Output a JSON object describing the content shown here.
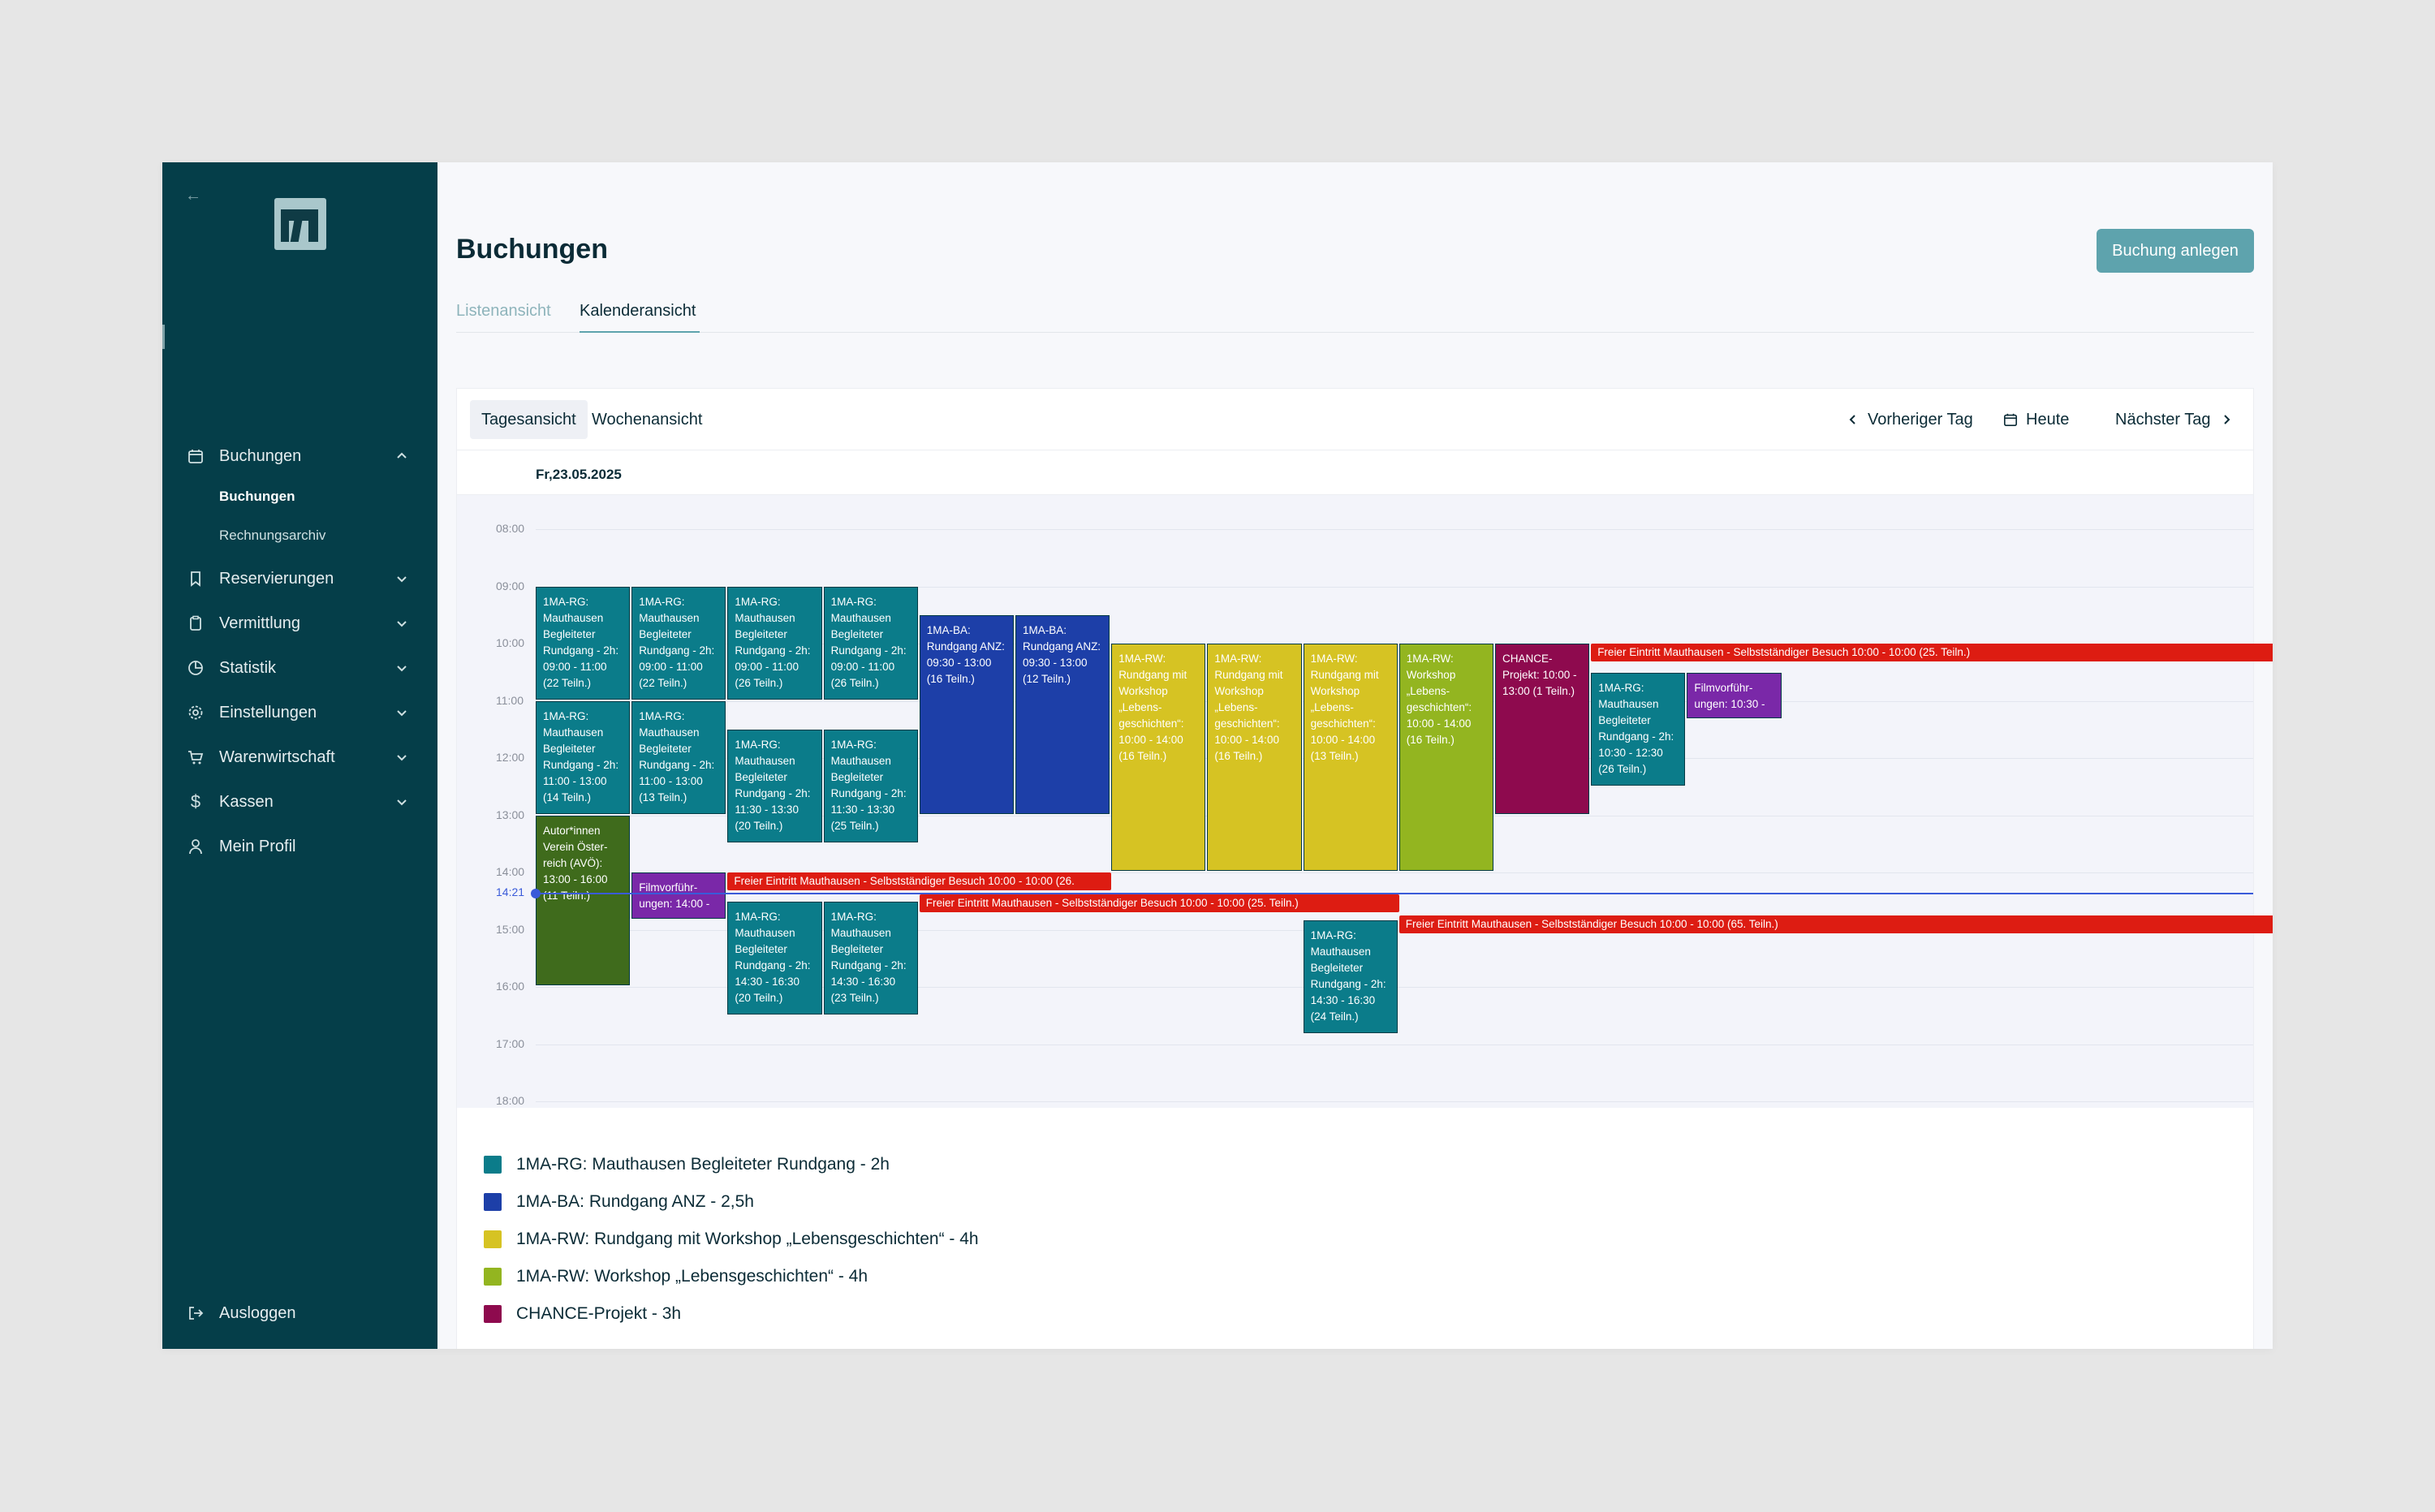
{
  "sidebar": {
    "groups": [
      {
        "label": "Buchungen",
        "icon": "calendar-icon",
        "expanded": true
      },
      {
        "label": "Reservierungen",
        "icon": "bookmark-icon"
      },
      {
        "label": "Vermittlung",
        "icon": "clipboard-icon"
      },
      {
        "label": "Statistik",
        "icon": "pie-chart-icon"
      },
      {
        "label": "Einstellungen",
        "icon": "gear-icon"
      },
      {
        "label": "Warenwirtschaft",
        "icon": "cart-icon"
      },
      {
        "label": "Kassen",
        "icon": "dollar-icon"
      },
      {
        "label": "Mein Profil",
        "icon": "user-icon"
      }
    ],
    "sub_items": [
      "Buchungen",
      "Rechnungsarchiv"
    ],
    "logout": "Ausloggen"
  },
  "header": {
    "title": "Buchungen",
    "create_button": "Buchung anlegen",
    "tabs": [
      "Listenansicht",
      "Kalenderansicht"
    ]
  },
  "calendar": {
    "views": [
      "Tagesansicht",
      "Wochenansicht"
    ],
    "prev": "Vorheriger Tag",
    "today": "Heute",
    "next": "Nächster Tag",
    "date": "Fr,23.05.2025",
    "hours": [
      "08:00",
      "09:00",
      "10:00",
      "11:00",
      "12:00",
      "13:00",
      "14:00",
      "15:00",
      "16:00",
      "17:00",
      "18:00"
    ],
    "now": "14:21",
    "events": [
      {
        "col": 0,
        "start": 9.0,
        "end": 11.0,
        "color": "#0b7c8a",
        "text": "1MA-RG: Mauthausen Begleiteter Rundgang - 2h: 09:00 - 11:00 (22 Teiln.)"
      },
      {
        "col": 1,
        "start": 9.0,
        "end": 11.0,
        "color": "#0b7c8a",
        "text": "1MA-RG: Mauthausen Begleiteter Rundgang - 2h: 09:00 - 11:00 (22 Teiln.)"
      },
      {
        "col": 2,
        "start": 9.0,
        "end": 11.0,
        "color": "#0b7c8a",
        "text": "1MA-RG: Mauthausen Begleiteter Rundgang - 2h: 09:00 - 11:00 (26 Teiln.)"
      },
      {
        "col": 3,
        "start": 9.0,
        "end": 11.0,
        "color": "#0b7c8a",
        "text": "1MA-RG: Mauthausen Begleiteter Rundgang - 2h: 09:00 - 11:00 (26 Teiln.)"
      },
      {
        "col": 4,
        "start": 9.5,
        "end": 13.0,
        "color": "#1d3fa8",
        "text": "1MA-BA: Rundgang ANZ: 09:30 - 13:00 (16 Teiln.)"
      },
      {
        "col": 5,
        "start": 9.5,
        "end": 13.0,
        "color": "#1d3fa8",
        "text": "1MA-BA: Rundgang ANZ: 09:30 - 13:00 (12 Teiln.)"
      },
      {
        "col": 6,
        "start": 10.0,
        "end": 14.0,
        "color": "#d6c323",
        "text": "1MA-RW: Rundgang mit Workshop „Lebens-geschichten“: 10:00 - 14:00 (16 Teiln.)"
      },
      {
        "col": 7,
        "start": 10.0,
        "end": 14.0,
        "color": "#d6c323",
        "text": "1MA-RW: Rundgang mit Workshop „Lebens-geschichten“: 10:00 - 14:00 (16 Teiln.)"
      },
      {
        "col": 8,
        "start": 10.0,
        "end": 14.0,
        "color": "#d6c323",
        "text": "1MA-RW: Rundgang mit Workshop „Lebens-geschichten“: 10:00 - 14:00 (13 Teiln.)"
      },
      {
        "col": 9,
        "start": 10.0,
        "end": 14.0,
        "color": "#93b520",
        "text": "1MA-RW: Workshop „Lebens-geschichten“: 10:00 - 14:00 (16 Teiln.)"
      },
      {
        "col": 10,
        "start": 10.0,
        "end": 13.0,
        "color": "#8e0a4e",
        "text": "CHANCE-Projekt: 10:00 - 13:00 (1 Teiln.)"
      },
      {
        "col": 11,
        "start": 10.5,
        "end": 12.5,
        "color": "#0b7c8a",
        "text": "1MA-RG: Mauthausen Begleiteter Rundgang - 2h: 10:30 - 12:30 (26 Teiln.)"
      },
      {
        "col": 12,
        "start": 10.5,
        "end": 11.33,
        "color": "#7a28a8",
        "text": "Filmvorführ-ungen: 10:30 -"
      },
      {
        "col": 0,
        "start": 11.0,
        "end": 13.0,
        "color": "#0b7c8a",
        "text": "1MA-RG: Mauthausen Begleiteter Rundgang - 2h: 11:00 - 13:00 (14 Teiln.)"
      },
      {
        "col": 1,
        "start": 11.0,
        "end": 13.0,
        "color": "#0b7c8a",
        "text": "1MA-RG: Mauthausen Begleiteter Rundgang - 2h: 11:00 - 13:00 (13 Teiln.)"
      },
      {
        "col": 2,
        "start": 11.5,
        "end": 13.5,
        "color": "#0b7c8a",
        "text": "1MA-RG: Mauthausen Begleiteter Rundgang - 2h: 11:30 - 13:30 (20 Teiln.)"
      },
      {
        "col": 3,
        "start": 11.5,
        "end": 13.5,
        "color": "#0b7c8a",
        "text": "1MA-RG: Mauthausen Begleiteter Rundgang - 2h: 11:30 - 13:30 (25 Teiln.)"
      },
      {
        "col": 0,
        "start": 13.0,
        "end": 16.0,
        "color": "#3f6b1c",
        "text": "Autor*innen Verein Öster-reich (AVÖ): 13:00 - 16:00 (11 Teiln.)"
      },
      {
        "col": 1,
        "start": 14.0,
        "end": 14.83,
        "color": "#7a28a8",
        "text": "Filmvorführ-ungen: 14:00 -"
      },
      {
        "col": 2,
        "start": 14.5,
        "end": 16.5,
        "color": "#0b7c8a",
        "text": "1MA-RG: Mauthausen Begleiteter Rundgang - 2h: 14:30 - 16:30 (20 Teiln.)"
      },
      {
        "col": 3,
        "start": 14.5,
        "end": 16.5,
        "color": "#0b7c8a",
        "text": "1MA-RG: Mauthausen Begleiteter Rundgang - 2h: 14:30 - 16:30 (23 Teiln.)"
      },
      {
        "col": 8,
        "start": 14.83,
        "end": 16.83,
        "color": "#0b7c8a",
        "text": "1MA-RG: Mauthausen Begleiteter Rundgang - 2h: 14:30 - 16:30 (24 Teiln.)"
      }
    ],
    "bars": [
      {
        "col_start": 11,
        "col_end": 18.8,
        "start": 10.0,
        "color": "#dd1c12",
        "text": "Freier Eintritt Mauthausen - Selbstständiger Besuch 10:00 - 10:00 (25. Teiln.)"
      },
      {
        "col_start": 2,
        "col_end": 6,
        "start": 14.0,
        "color": "#dd1c12",
        "text": "Freier Eintritt Mauthausen - Selbstständiger Besuch 10:00 - 10:00 (26."
      },
      {
        "col_start": 4,
        "col_end": 9,
        "start": 14.38,
        "color": "#dd1c12",
        "text": "Freier Eintritt Mauthausen - Selbstständiger Besuch 10:00 - 10:00 (25. Teiln.)"
      },
      {
        "col_start": 9,
        "col_end": 18.8,
        "start": 14.75,
        "color": "#dd1c12",
        "text": "Freier Eintritt Mauthausen - Selbstständiger Besuch 10:00 - 10:00 (65. Teiln.)"
      }
    ]
  },
  "legend": [
    {
      "color": "#0b7c8a",
      "label": "1MA-RG: Mauthausen Begleiteter Rundgang - 2h"
    },
    {
      "color": "#1d3fa8",
      "label": "1MA-BA: Rundgang ANZ - 2,5h"
    },
    {
      "color": "#d6c323",
      "label": "1MA-RW: Rundgang mit Workshop „Lebensgeschichten“ - 4h"
    },
    {
      "color": "#93b520",
      "label": "1MA-RW: Workshop „Lebensgeschichten“ - 4h"
    },
    {
      "color": "#8e0a4e",
      "label": "CHANCE-Projekt - 3h"
    }
  ]
}
